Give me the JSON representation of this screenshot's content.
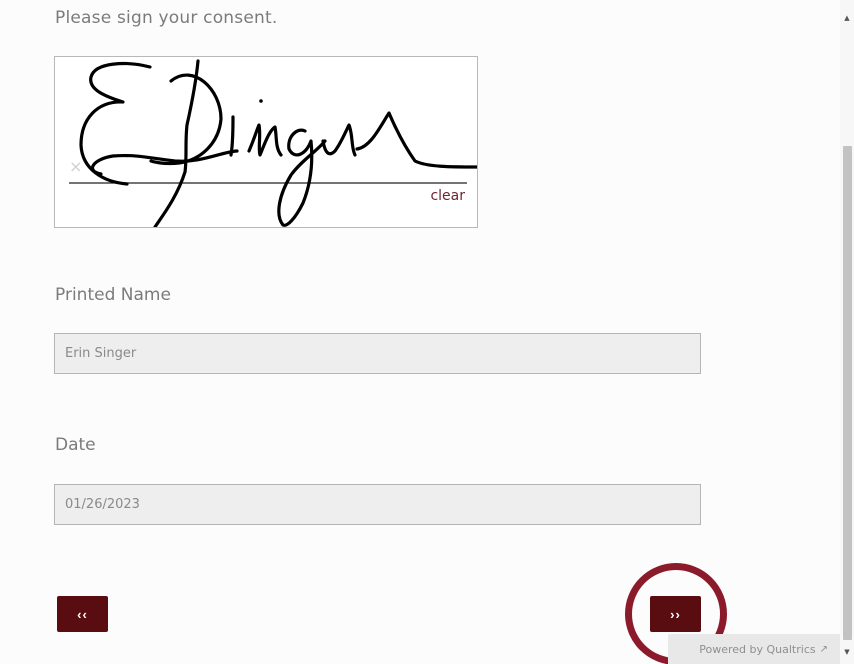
{
  "question": {
    "text": "Please sign your consent."
  },
  "signature": {
    "clear_label": "clear",
    "x_mark": "×"
  },
  "printed_name": {
    "label": "Printed Name",
    "value": "Erin Singer"
  },
  "date": {
    "label": "Date",
    "value": "01/26/2023"
  },
  "navigation": {
    "back_label": "‹‹",
    "next_label": "››"
  },
  "footer": {
    "powered_by": "Powered by Qualtrics",
    "ext_icon": "external-link-icon"
  },
  "colors": {
    "button": "#5a0d10",
    "highlight_ring": "#8b1a2b",
    "clear_link": "#6e2430"
  }
}
